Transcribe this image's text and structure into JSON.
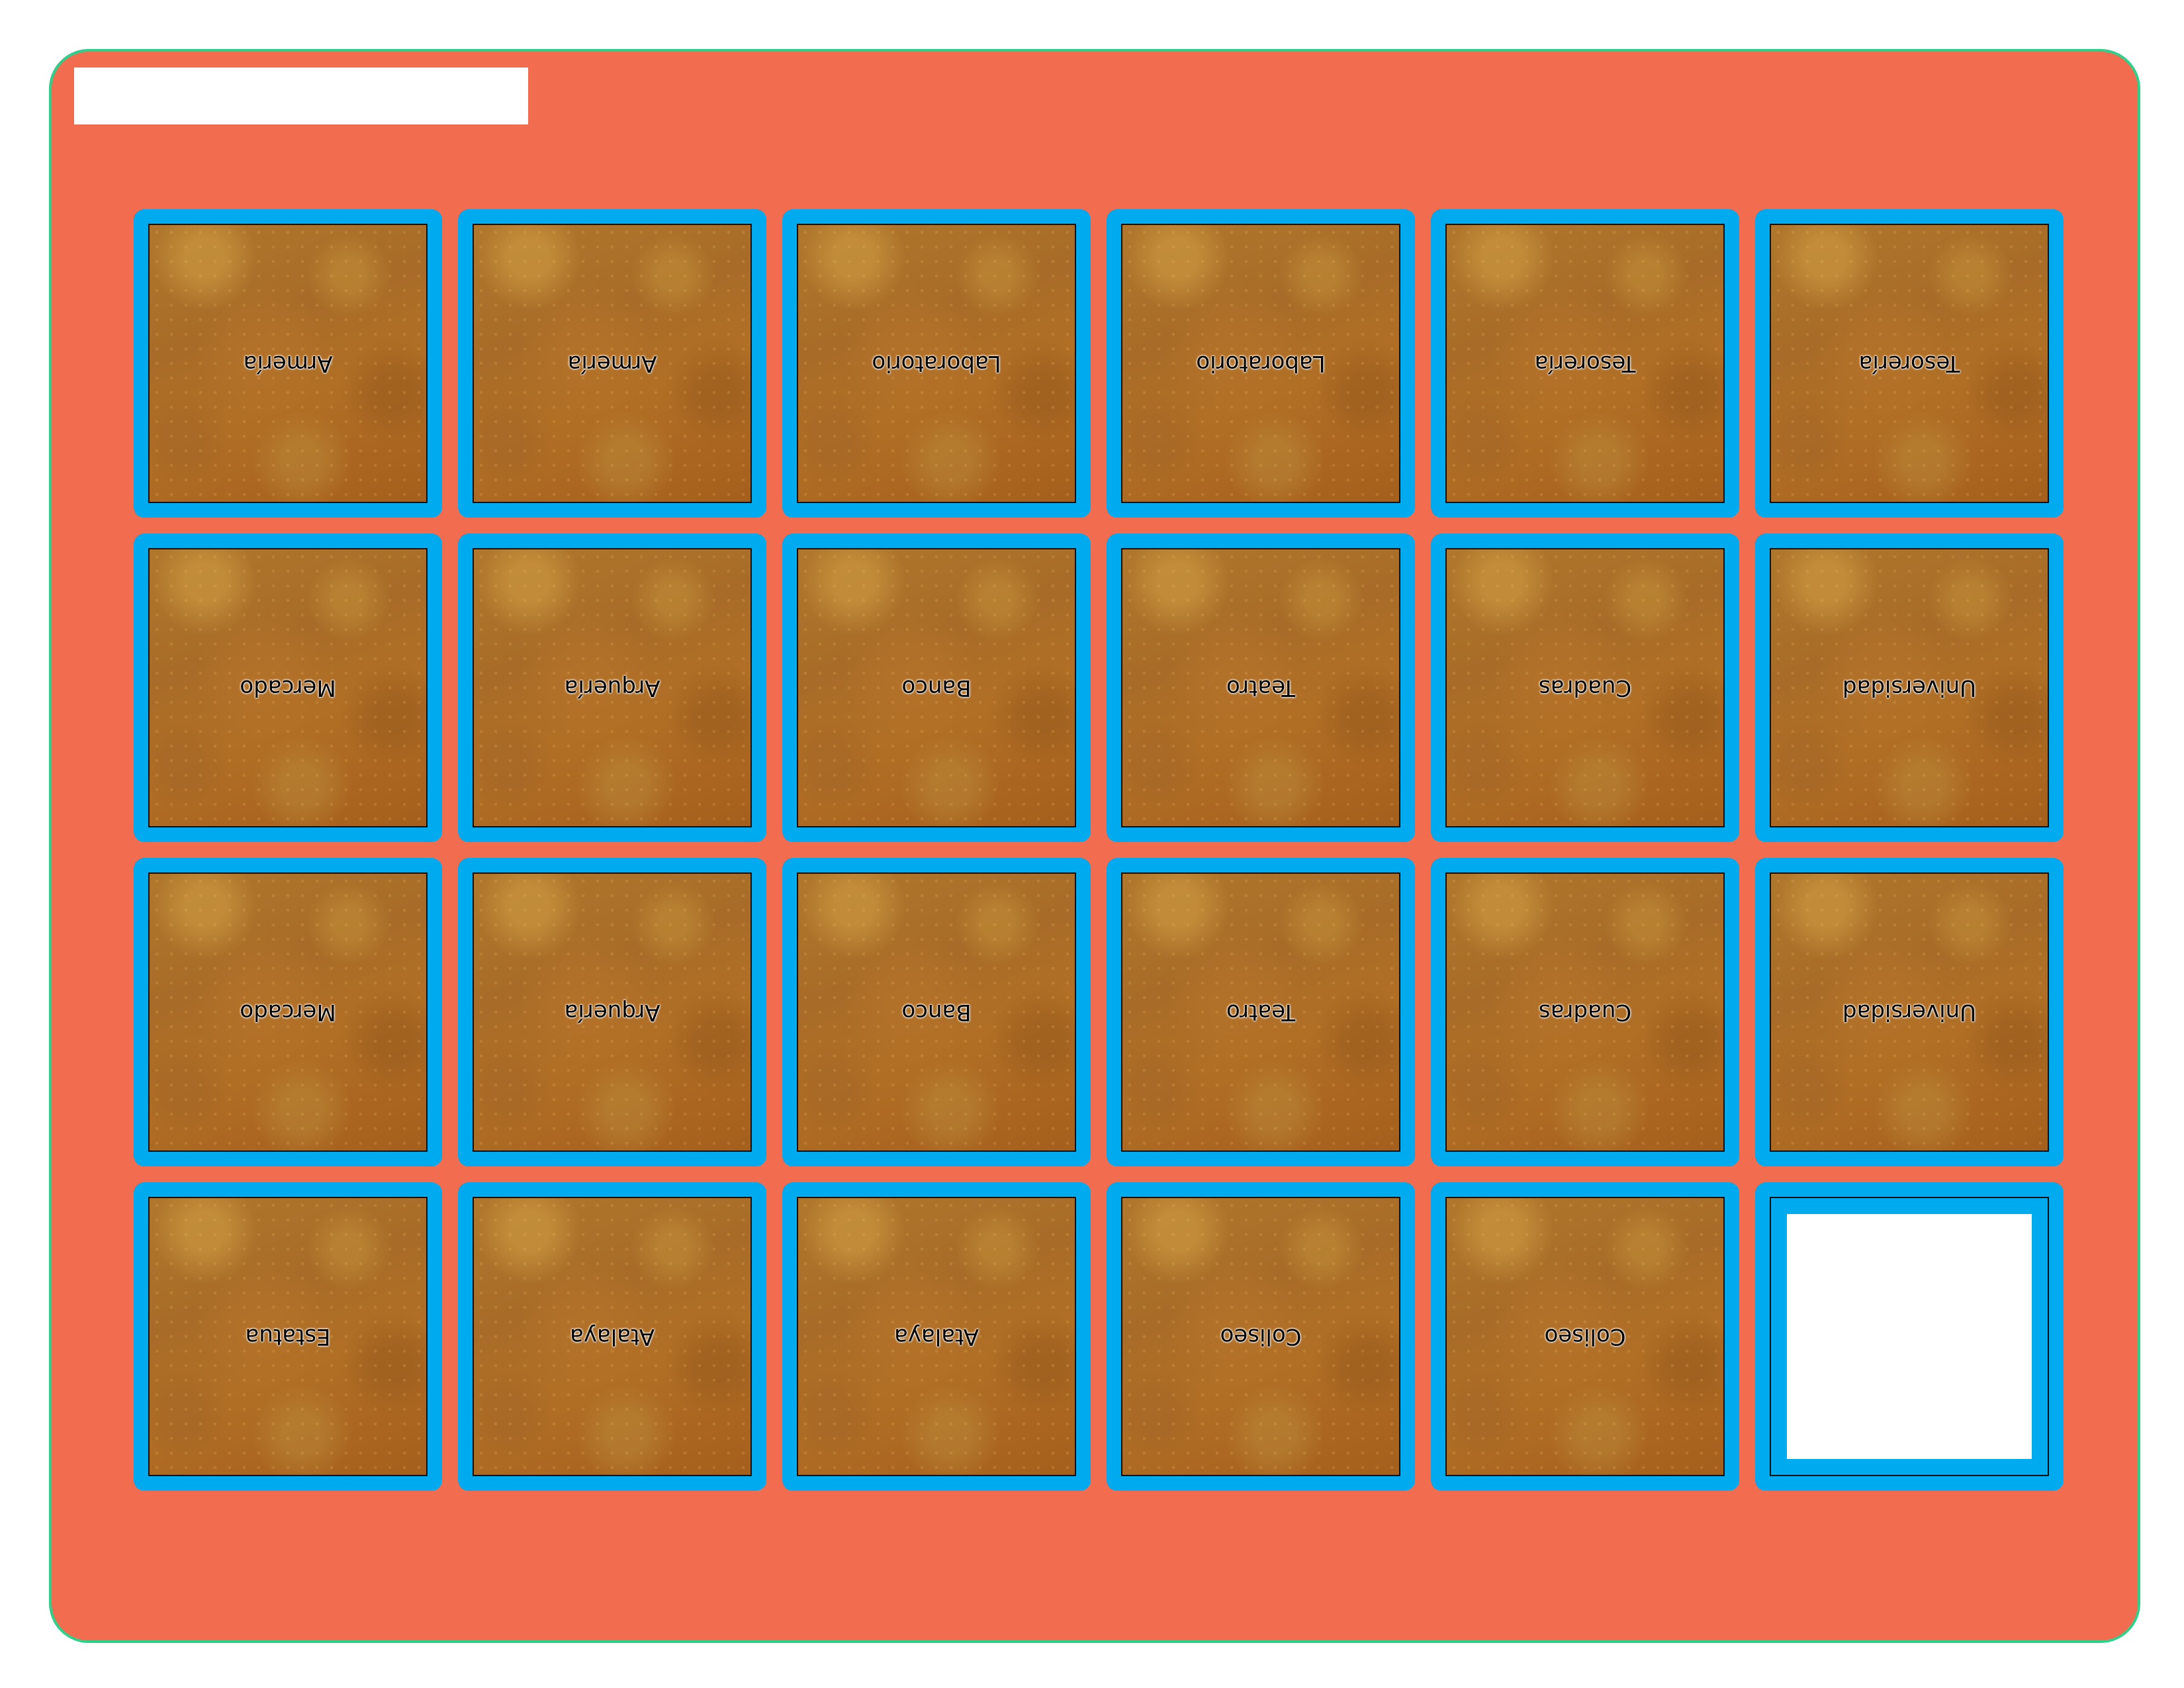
{
  "colors": {
    "board_background": "#f26d50",
    "board_border": "#2fd08a",
    "card_frame": "#00aaee",
    "card_back": "#a86c28"
  },
  "header": {
    "title": ""
  },
  "cards": [
    {
      "label": "Armería"
    },
    {
      "label": "Armería"
    },
    {
      "label": "Laboratorio"
    },
    {
      "label": "Laboratorio"
    },
    {
      "label": "Tesorería"
    },
    {
      "label": "Tesorería"
    },
    {
      "label": "Mercado"
    },
    {
      "label": "Arquería"
    },
    {
      "label": "Banco"
    },
    {
      "label": "Teatro"
    },
    {
      "label": "Cuadras"
    },
    {
      "label": "Universidad"
    },
    {
      "label": "Mercado"
    },
    {
      "label": "Arquería"
    },
    {
      "label": "Banco"
    },
    {
      "label": "Teatro"
    },
    {
      "label": "Cuadras"
    },
    {
      "label": "Universidad"
    },
    {
      "label": "Estatua"
    },
    {
      "label": "Atalaya"
    },
    {
      "label": "Atalaya"
    },
    {
      "label": "Coliseo"
    },
    {
      "label": "Coliseo"
    },
    {
      "label": ""
    }
  ]
}
